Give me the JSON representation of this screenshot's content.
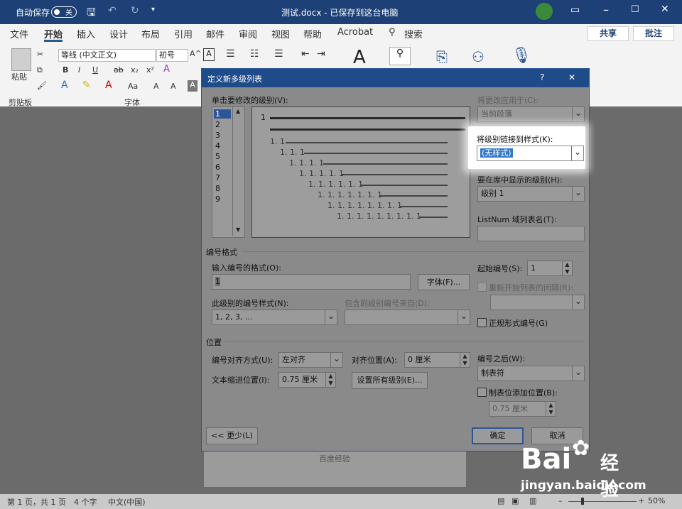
{
  "titlebar": {
    "autosave_label": "自动保存",
    "autosave_state": "关",
    "title": "测试.docx - 已保存到这台电脑"
  },
  "tabs": [
    "文件",
    "开始",
    "插入",
    "设计",
    "布局",
    "引用",
    "邮件",
    "审阅",
    "视图",
    "帮助",
    "Acrobat",
    "搜索"
  ],
  "share": "共享",
  "comment": "批注",
  "ribbon": {
    "paste": "粘贴",
    "clipboard": "剪贴板",
    "font_name": "等线 (中文正文)",
    "font_size": "初号",
    "font_group": "字体",
    "aa": "Aa"
  },
  "dialog": {
    "title": "定义新多级列表",
    "help": "?",
    "close": "✕",
    "click_level_label": "单击要修改的级别(V):",
    "levels": [
      "1",
      "2",
      "3",
      "4",
      "5",
      "6",
      "7",
      "8",
      "9"
    ],
    "preview": [
      "1",
      "1. 1",
      "1. 1. 1",
      "1. 1. 1. 1",
      "1. 1. 1. 1. 1",
      "1. 1. 1. 1. 1. 1",
      "1. 1. 1. 1. 1. 1. 1",
      "1. 1. 1. 1. 1. 1. 1. 1",
      "1. 1. 1. 1. 1. 1. 1. 1. 1"
    ],
    "apply_to_label": "将更改应用于(C):",
    "apply_to_value": "当前段落",
    "link_style_label": "将级别链接到样式(K):",
    "link_style_value": "(无样式)",
    "gallery_level_label": "要在库中显示的级别(H):",
    "gallery_level_value": "级别 1",
    "listnum_label": "ListNum 域列表名(T):",
    "numfmt_section": "编号格式",
    "enter_format_label": "输入编号的格式(O):",
    "enter_format_value": "1",
    "font_button": "字体(F)...",
    "start_at_label": "起始编号(S):",
    "start_at_value": "1",
    "restart_label": "重新开始列表的间隔(R):",
    "numstyle_label": "此级别的编号样式(N):",
    "numstyle_value": "1, 2, 3, ...",
    "include_label": "包含的级别编号来自(D):",
    "legal_label": "正规形式编号(G)",
    "position_section": "位置",
    "align_label": "编号对齐方式(U):",
    "align_value": "左对齐",
    "align_at_label": "对齐位置(A):",
    "align_at_value": "0 厘米",
    "indent_label": "文本缩进位置(I):",
    "indent_value": "0.75 厘米",
    "set_all_button": "设置所有级别(E)...",
    "follow_label": "编号之后(W):",
    "follow_value": "制表符",
    "tabstop_label": "制表位添加位置(B):",
    "tabstop_value": "0.75 厘米",
    "less_button": "<< 更少(L)",
    "ok_button": "确定",
    "cancel_button": "取消"
  },
  "doc": {
    "text": "百度经验"
  },
  "status": {
    "page": "第 1 页，共 1 页",
    "words": "4 个字",
    "lang": "中文(中国)",
    "zoom": "50%"
  },
  "watermark": {
    "brand": "Bai",
    "brand2": "经验",
    "url": "jingyan.baidu.com"
  }
}
